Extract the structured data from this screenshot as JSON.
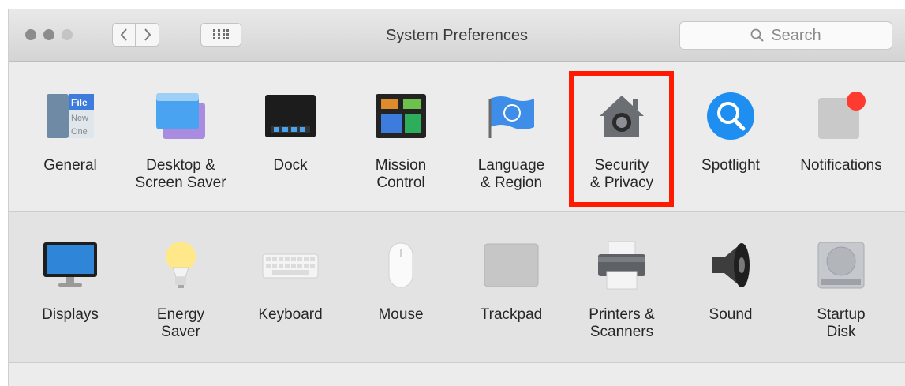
{
  "window": {
    "title": "System Preferences",
    "search": {
      "placeholder": "Search"
    }
  },
  "row1": [
    {
      "label": "General",
      "icon": "general-icon"
    },
    {
      "label": "Desktop &\nScreen Saver",
      "icon": "desktop-screen-saver-icon"
    },
    {
      "label": "Dock",
      "icon": "dock-icon"
    },
    {
      "label": "Mission\nControl",
      "icon": "mission-control-icon"
    },
    {
      "label": "Language\n& Region",
      "icon": "flag-icon"
    },
    {
      "label": "Security\n& Privacy",
      "icon": "house-lock-icon"
    },
    {
      "label": "Spotlight",
      "icon": "magnifier-icon"
    },
    {
      "label": "Notifications",
      "icon": "notifications-icon"
    }
  ],
  "row2": [
    {
      "label": "Displays",
      "icon": "monitor-icon"
    },
    {
      "label": "Energy\nSaver",
      "icon": "lightbulb-icon"
    },
    {
      "label": "Keyboard",
      "icon": "keyboard-icon"
    },
    {
      "label": "Mouse",
      "icon": "mouse-icon"
    },
    {
      "label": "Trackpad",
      "icon": "trackpad-icon"
    },
    {
      "label": "Printers &\nScanners",
      "icon": "printer-icon"
    },
    {
      "label": "Sound",
      "icon": "speaker-icon"
    },
    {
      "label": "Startup\nDisk",
      "icon": "hard-disk-icon"
    }
  ],
  "general_icon_text": [
    "File",
    "New",
    "One"
  ],
  "colors": {
    "highlight": "#ff1a00",
    "notification_badge": "#ff3b30",
    "spotlight_blue": "#1f8ef1"
  }
}
